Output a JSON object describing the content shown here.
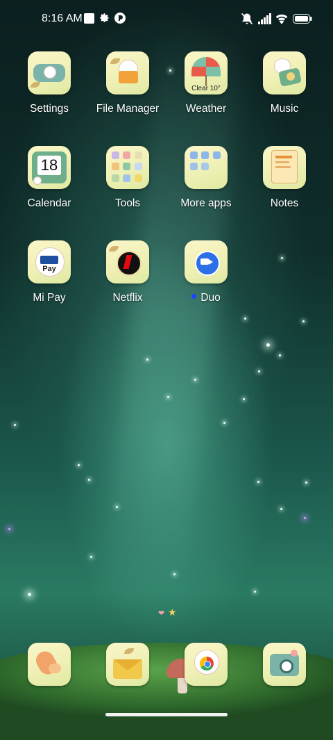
{
  "status_bar": {
    "time": "8:16 AM",
    "left_icons": [
      "square-notification-icon",
      "gear-icon",
      "app-notification-icon"
    ],
    "right_icons": [
      "mute-icon",
      "signal-icon",
      "wifi-icon",
      "battery-icon"
    ]
  },
  "apps": [
    {
      "label": "Settings"
    },
    {
      "label": "File Manager"
    },
    {
      "label": "Weather",
      "tile_text": "Clear 10°"
    },
    {
      "label": "Music"
    },
    {
      "label": "Calendar",
      "tile_text": "18"
    },
    {
      "label": "Tools"
    },
    {
      "label": "More apps"
    },
    {
      "label": "Notes"
    },
    {
      "label": "Mi Pay",
      "tile_text": "Pay"
    },
    {
      "label": "Netflix"
    },
    {
      "label": "Duo",
      "badge": "new-app-dot"
    }
  ],
  "dock": [
    {
      "name": "phone"
    },
    {
      "name": "messages"
    },
    {
      "name": "chrome"
    },
    {
      "name": "camera"
    }
  ],
  "colors": {
    "tile": "#f3f2be",
    "new_dot": "#1a44ff",
    "wallpaper_top": "#0b1f1f",
    "wallpaper_glow": "#2a7a63"
  }
}
